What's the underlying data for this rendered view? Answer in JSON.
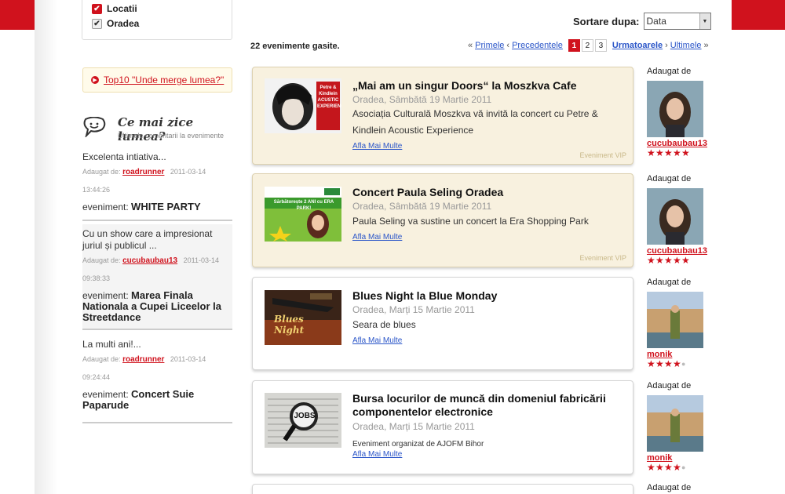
{
  "filters": {
    "items": [
      {
        "label": "Locatii",
        "checked": true,
        "style": "red"
      },
      {
        "label": "Oradea",
        "checked": true,
        "style": "gray"
      }
    ]
  },
  "top10": {
    "label": "Top10 \"Unde merge lumea?\""
  },
  "comments": {
    "title": "Ce mai zice lumea?",
    "subtitle": "Ultimele comentarii la evenimente",
    "items": [
      {
        "text": "Excelenta intiativa...",
        "added_prefix": "Adaugat de:",
        "user": "roadrunner",
        "date": "2011-03-14",
        "time": "13:44:26",
        "event_prefix": "eveniment:",
        "event": "WHITE PARTY"
      },
      {
        "text": "Cu un show care a impresionat juriul și publicul ...",
        "added_prefix": "Adaugat de:",
        "user": "cucubaubau13",
        "date": "2011-03-14",
        "time": "09:38:33",
        "event_prefix": "eveniment:",
        "event": "Marea Finala Nationala a Cupei Liceelor la Streetdance"
      },
      {
        "text": "La multi ani!...",
        "added_prefix": "Adaugat de:",
        "user": "roadrunner",
        "date": "2011-03-14",
        "time": "09:24:44",
        "event_prefix": "eveniment:",
        "event": "Concert Suie Paparude"
      }
    ]
  },
  "sort": {
    "label": "Sortare dupa:",
    "value": "Data"
  },
  "results": {
    "count_text": "22 evenimente gasite."
  },
  "pager": {
    "first": "Primele",
    "prev": "Precedentele",
    "pages": [
      "1",
      "2",
      "3"
    ],
    "current": "1",
    "next": "Urmatoarele",
    "last": "Ultimele",
    "lq": "«",
    "pl": "‹",
    "nr": "›",
    "rq": "»"
  },
  "events": [
    {
      "title": "„Mai am un singur Doors“ la Moszkva Cafe",
      "date": "Oradea, Sâmbătă 19 Martie 2011",
      "desc": "Asociația Culturală Moszkva vă invită la concert cu Petre & Kindlein Acoustic Experience",
      "more": "Afla Mai Multe",
      "vip": "Eveniment VIP",
      "poster_text": "Petre & Kindlein ACUSTIC EXPERIENCE"
    },
    {
      "title": "Concert Paula Seling Oradea",
      "date": "Oradea, Sâmbătă 19 Martie 2011",
      "desc": "Paula Seling va sustine un concert la Era Shopping Park",
      "more": "Afla Mai Multe",
      "vip": "Eveniment VIP",
      "poster_text": "Sărbătorește 2 ANI cu ERA PARK!"
    },
    {
      "title": "Blues Night la Blue Monday",
      "date": "Oradea, Marți 15 Martie 2011",
      "desc": "Seara de blues",
      "more": "Afla Mai Multe",
      "poster_text": "Blues Night"
    },
    {
      "title": "Bursa locurilor de muncă din domeniul fabricării componentelor electronice",
      "date": "Oradea, Marți 15 Martie 2011",
      "desc": "Eveniment organizat de AJOFM Bihor",
      "more": "Afla Mai Multe",
      "poster_text": "JOBS"
    }
  ],
  "added_by": {
    "label": "Adaugat de",
    "items": [
      {
        "user": "cucubaubau13",
        "stars": 5
      },
      {
        "user": "cucubaubau13",
        "stars": 5
      },
      {
        "user": "monik",
        "stars": 4
      },
      {
        "user": "monik",
        "stars": 4
      },
      {
        "user": "",
        "stars": 0
      }
    ]
  },
  "colors": {
    "brand_red": "#d0121d",
    "vip_bg": "#f8f1df",
    "link_blue": "#2a55c8"
  }
}
